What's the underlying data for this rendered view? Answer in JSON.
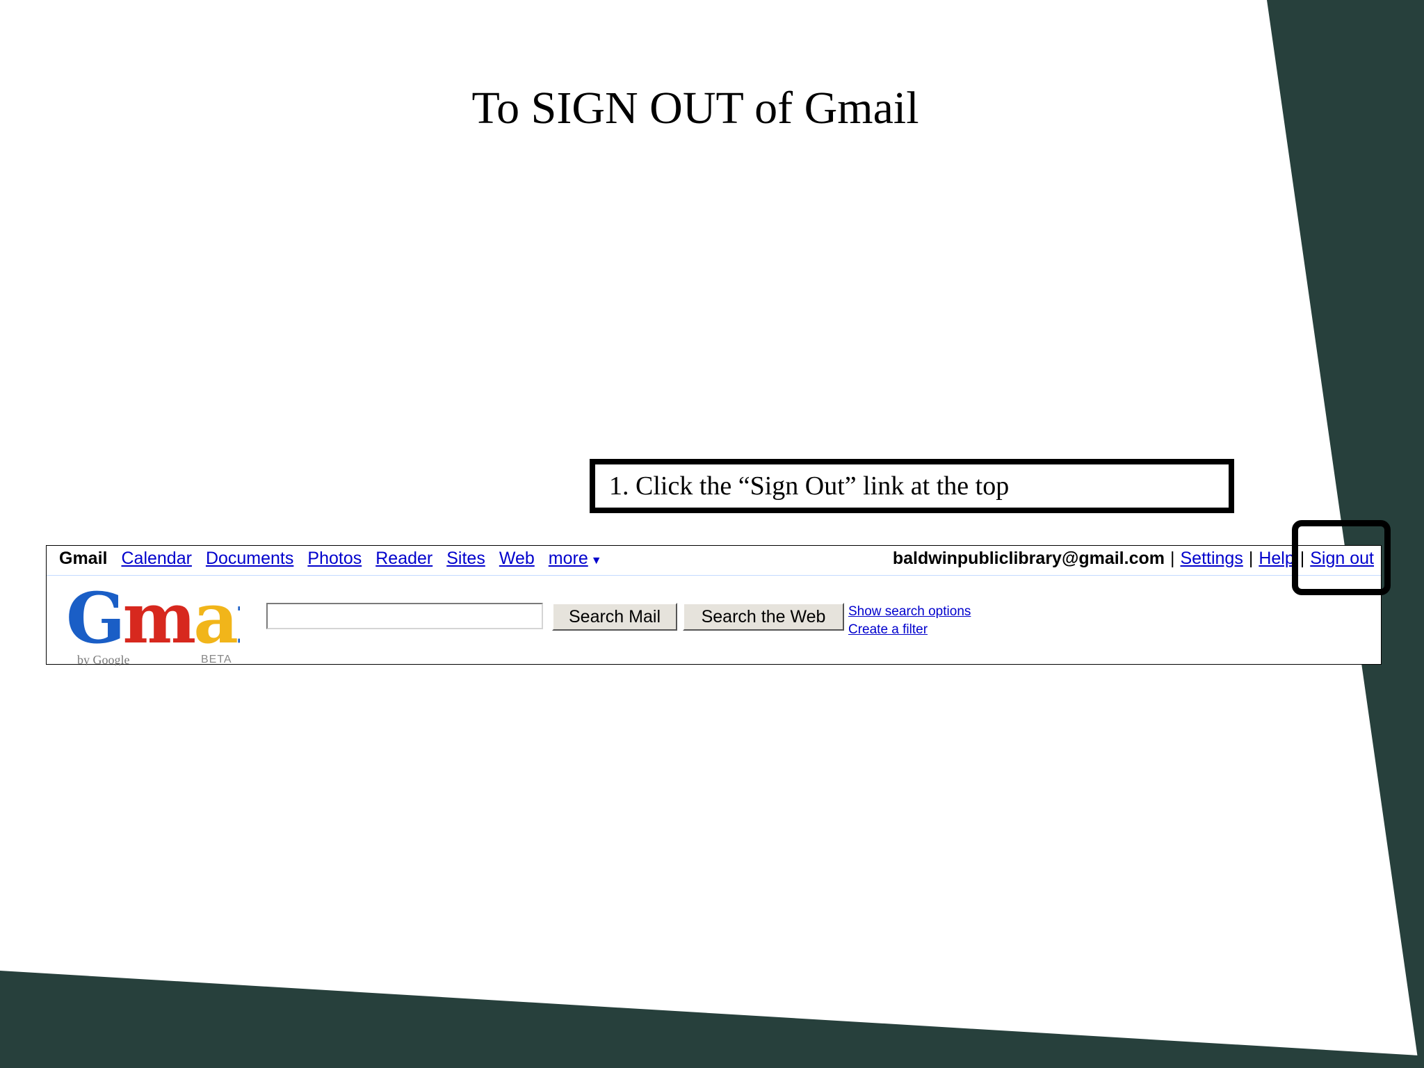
{
  "slide": {
    "title": "To SIGN OUT of Gmail",
    "instruction": "1. Click the “Sign Out” link at the top"
  },
  "theme": {
    "accent": "#27403c",
    "link": "#0000cc"
  },
  "gmail": {
    "nav": {
      "current": "Gmail",
      "links": [
        "Calendar",
        "Documents",
        "Photos",
        "Reader",
        "Sites",
        "Web",
        "more"
      ],
      "more_icon": "triangle-down-icon"
    },
    "account": {
      "email": "baldwinpubliclibrary@gmail.com",
      "settings": "Settings",
      "help": "Help",
      "sign_out": "Sign out",
      "separator": "|"
    },
    "logo": {
      "text": "Gmail",
      "by": "by Google",
      "beta": "BETA"
    },
    "search": {
      "value": "",
      "search_mail": "Search Mail",
      "search_web": "Search the Web",
      "show_options": "Show search options",
      "create_filter": "Create a filter"
    }
  }
}
